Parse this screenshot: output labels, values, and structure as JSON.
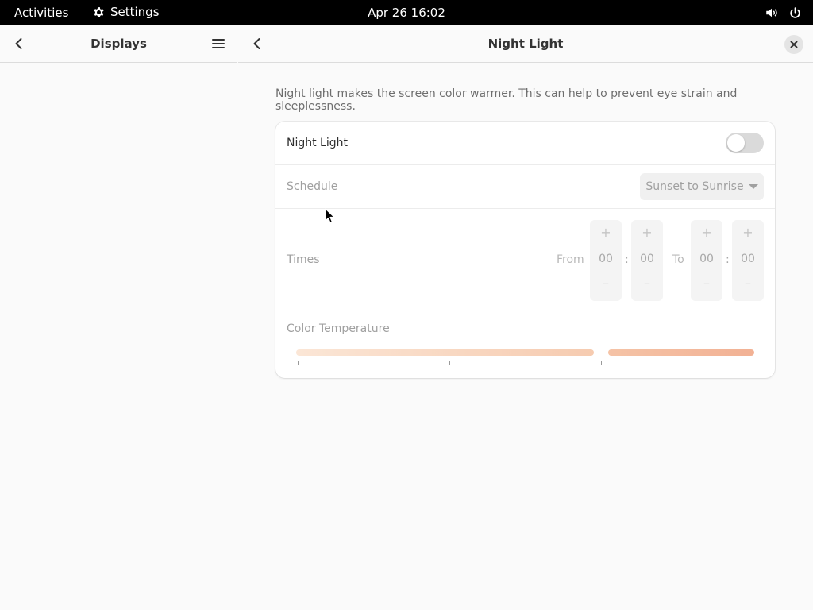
{
  "topbar": {
    "activities": "Activities",
    "app_name": "Settings",
    "clock": "Apr 26  16:02",
    "icons": [
      "gear-icon",
      "volume-icon",
      "power-icon"
    ]
  },
  "sidebar": {
    "title": "Displays",
    "icons": [
      "back-arrow-icon",
      "hamburger-menu-icon"
    ]
  },
  "main": {
    "title": "Night Light",
    "description": "Night light makes the screen color warmer. This can help to prevent eye strain and sleeplessness.",
    "night_light": {
      "label": "Night Light",
      "enabled": false
    },
    "schedule": {
      "label": "Schedule",
      "selected": "Sunset to Sunrise"
    },
    "times": {
      "label": "Times",
      "from_label": "From",
      "to_label": "To",
      "plus": "+",
      "minus": "–",
      "colon": ":",
      "from_hour": "00",
      "from_minute": "00",
      "to_hour": "00",
      "to_minute": "00"
    },
    "color_temperature": {
      "label": "Color Temperature",
      "value_fraction": 0.66,
      "colors": {
        "start": "#fbe6d6",
        "end": "#f2b194"
      }
    }
  },
  "colors": {
    "topbar": "#000000",
    "background": "#fafafa",
    "card": "#ffffff",
    "disabled_text": "#a0a0a0"
  }
}
